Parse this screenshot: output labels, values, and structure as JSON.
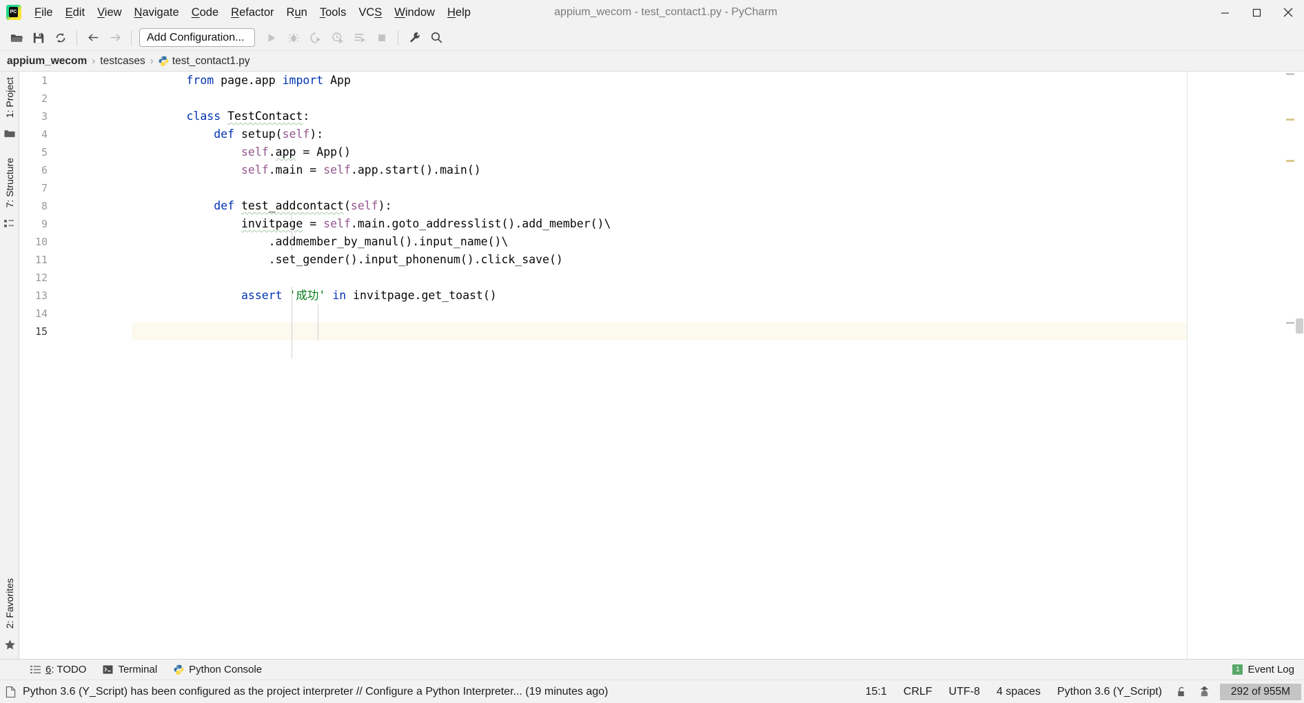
{
  "window": {
    "title": "appium_wecom - test_contact1.py - PyCharm",
    "minimize": "─",
    "maximize": "❐",
    "close": "✕",
    "logo_text": "PC"
  },
  "menubar": {
    "items": [
      {
        "label": "File",
        "mnemonic": "F"
      },
      {
        "label": "Edit",
        "mnemonic": "E"
      },
      {
        "label": "View",
        "mnemonic": "V"
      },
      {
        "label": "Navigate",
        "mnemonic": "N"
      },
      {
        "label": "Code",
        "mnemonic": "C"
      },
      {
        "label": "Refactor",
        "mnemonic": "R"
      },
      {
        "label": "Run",
        "mnemonic": "u"
      },
      {
        "label": "Tools",
        "mnemonic": "T"
      },
      {
        "label": "VCS",
        "mnemonic": "S"
      },
      {
        "label": "Window",
        "mnemonic": "W"
      },
      {
        "label": "Help",
        "mnemonic": "H"
      }
    ]
  },
  "toolbar": {
    "open_tooltip": "Open",
    "save_tooltip": "Save All",
    "sync_tooltip": "Synchronize",
    "back_tooltip": "Back",
    "forward_tooltip": "Forward",
    "add_configuration": "Add Configuration...",
    "run_tooltip": "Run",
    "debug_tooltip": "Debug",
    "coverage_tooltip": "Run with Coverage",
    "profile_tooltip": "Profile",
    "run_tests_tooltip": "Run Tests",
    "stop_tooltip": "Stop",
    "settings_tooltip": "Settings",
    "search_tooltip": "Search Everywhere"
  },
  "breadcrumb": {
    "separator": "›",
    "items": [
      {
        "label": "appium_wecom",
        "bold": true,
        "icon": false
      },
      {
        "label": "testcases",
        "bold": false,
        "icon": false
      },
      {
        "label": "test_contact1.py",
        "bold": false,
        "icon": true
      }
    ]
  },
  "left_tool_window": {
    "project_label": "1: Project",
    "project_mnemonic": "1",
    "structure_label": "7: Structure",
    "structure_mnemonic": "7",
    "favorites_label": "2: Favorites",
    "favorites_mnemonic": "2"
  },
  "editor": {
    "current_line": 15,
    "line_numbers": [
      1,
      2,
      3,
      4,
      5,
      6,
      7,
      8,
      9,
      10,
      11,
      12,
      13,
      14,
      15
    ],
    "lines": [
      {
        "n": 1,
        "tokens": [
          {
            "t": "        ",
            "c": "plain"
          },
          {
            "t": "from",
            "c": "kw"
          },
          {
            "t": " page.app ",
            "c": "plain"
          },
          {
            "t": "import",
            "c": "kw"
          },
          {
            "t": " App",
            "c": "plain"
          }
        ]
      },
      {
        "n": 2,
        "tokens": []
      },
      {
        "n": 3,
        "tokens": [
          {
            "t": "        ",
            "c": "plain"
          },
          {
            "t": "class",
            "c": "kw"
          },
          {
            "t": " ",
            "c": "plain"
          },
          {
            "t": "TestContact",
            "c": "wavy"
          },
          {
            "t": ":",
            "c": "plain"
          }
        ]
      },
      {
        "n": 4,
        "tokens": [
          {
            "t": "            ",
            "c": "plain"
          },
          {
            "t": "def",
            "c": "kw"
          },
          {
            "t": " setup(",
            "c": "plain"
          },
          {
            "t": "self",
            "c": "self"
          },
          {
            "t": "):",
            "c": "plain"
          }
        ]
      },
      {
        "n": 5,
        "tokens": [
          {
            "t": "                ",
            "c": "plain"
          },
          {
            "t": "self",
            "c": "self"
          },
          {
            "t": ".",
            "c": "plain"
          },
          {
            "t": "app",
            "c": "wavy"
          },
          {
            "t": " = App()",
            "c": "plain"
          }
        ]
      },
      {
        "n": 6,
        "tokens": [
          {
            "t": "                ",
            "c": "plain"
          },
          {
            "t": "self",
            "c": "self"
          },
          {
            "t": ".main = ",
            "c": "plain"
          },
          {
            "t": "self",
            "c": "self"
          },
          {
            "t": ".app.start().main()",
            "c": "plain"
          }
        ]
      },
      {
        "n": 7,
        "tokens": []
      },
      {
        "n": 8,
        "tokens": [
          {
            "t": "            ",
            "c": "plain"
          },
          {
            "t": "def",
            "c": "kw"
          },
          {
            "t": " ",
            "c": "plain"
          },
          {
            "t": "test_addcontact",
            "c": "wavy"
          },
          {
            "t": "(",
            "c": "plain"
          },
          {
            "t": "self",
            "c": "self"
          },
          {
            "t": "):",
            "c": "plain"
          }
        ]
      },
      {
        "n": 9,
        "tokens": [
          {
            "t": "                ",
            "c": "plain"
          },
          {
            "t": "invitpage",
            "c": "wavy"
          },
          {
            "t": " = ",
            "c": "plain"
          },
          {
            "t": "self",
            "c": "self"
          },
          {
            "t": ".main.goto_addresslist().add_member()\\",
            "c": "plain"
          }
        ]
      },
      {
        "n": 10,
        "tokens": [
          {
            "t": "                    .addmember_by_manul().input_name()\\",
            "c": "plain"
          }
        ]
      },
      {
        "n": 11,
        "tokens": [
          {
            "t": "                    .set_gender().input_phonenum().click_save()",
            "c": "plain"
          }
        ]
      },
      {
        "n": 12,
        "tokens": []
      },
      {
        "n": 13,
        "tokens": [
          {
            "t": "                ",
            "c": "plain"
          },
          {
            "t": "assert",
            "c": "kw"
          },
          {
            "t": " ",
            "c": "plain"
          },
          {
            "t": "'成功'",
            "c": "str"
          },
          {
            "t": " ",
            "c": "plain"
          },
          {
            "t": "in",
            "c": "kw"
          },
          {
            "t": " invitpage.get_toast()",
            "c": "plain"
          }
        ]
      },
      {
        "n": 14,
        "tokens": []
      },
      {
        "n": 15,
        "tokens": []
      }
    ]
  },
  "bottom_bar": {
    "items": [
      {
        "label": "6: TODO",
        "mnemonic": "6",
        "icon": "todo-icon"
      },
      {
        "label": "Terminal",
        "mnemonic": "",
        "icon": "terminal-icon"
      },
      {
        "label": "Python Console",
        "mnemonic": "",
        "icon": "python-icon"
      }
    ],
    "event_log": {
      "label": "Event Log",
      "badge": "1"
    }
  },
  "statusbar": {
    "message": "Python 3.6 (Y_Script) has been configured as the project interpreter // Configure a Python Interpreter... (19 minutes ago)",
    "caret": "15:1",
    "line_separator": "CRLF",
    "encoding": "UTF-8",
    "indent": "4 spaces",
    "interpreter": "Python 3.6 (Y_Script)",
    "lock_tooltip": "Make file read-only",
    "hector_tooltip": "Highlighting level",
    "memory": "292 of 955M"
  },
  "colors": {
    "keyword": "#0033b3",
    "string": "#067d17",
    "self": "#94558d",
    "plain_text": "#080808",
    "accent_green": "#59a869",
    "current_line_bg": "#fcfaef",
    "chrome_bg": "#f2f2f2",
    "editor_bg": "#ffffff"
  }
}
